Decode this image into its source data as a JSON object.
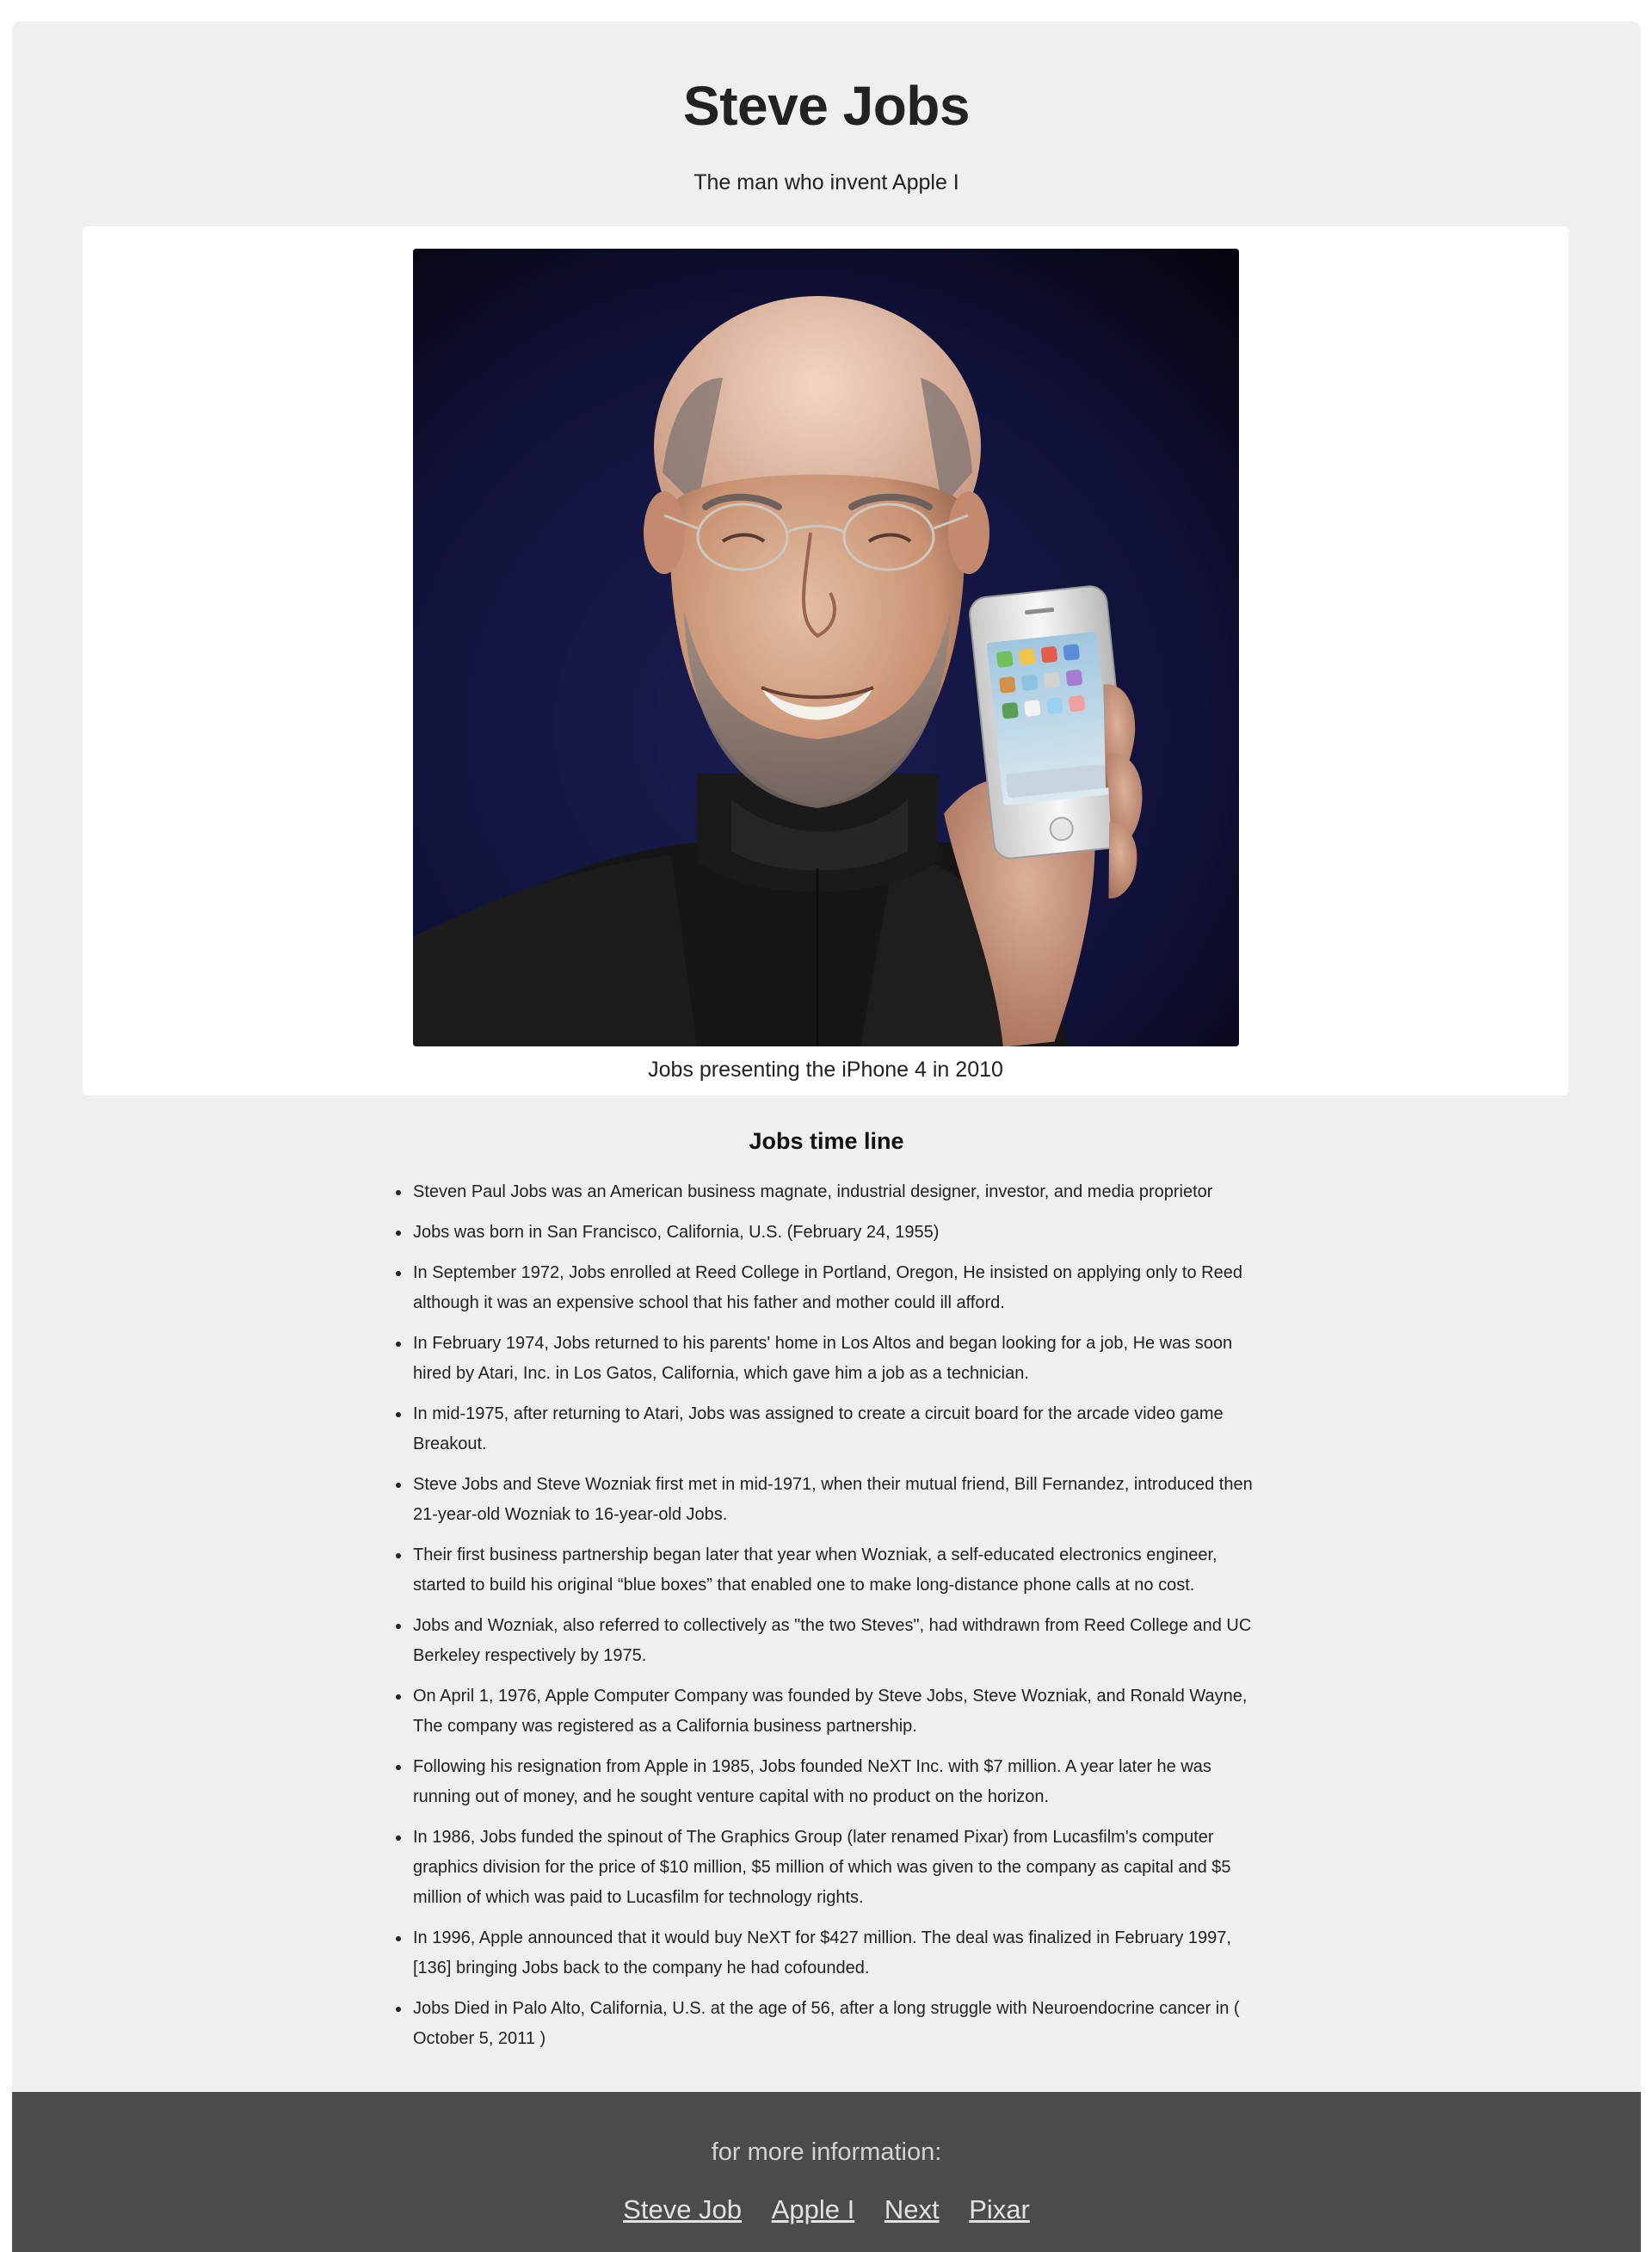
{
  "page": {
    "title": "Steve Jobs",
    "subtitle": "The man who invent Apple I"
  },
  "figure": {
    "image_alt": "Steve Jobs smiling and holding up an iPhone 4",
    "caption": "Jobs presenting the iPhone 4 in 2010"
  },
  "timeline": {
    "heading": "Jobs time line",
    "items": [
      "Steven Paul Jobs was an American business magnate, industrial designer, investor, and media proprietor",
      "Jobs was born in San Francisco, California, U.S. (February 24, 1955)",
      "In September 1972, Jobs enrolled at Reed College in Portland, Oregon, He insisted on applying only to Reed although it was an expensive school that his father and mother could ill afford.",
      "In February 1974, Jobs returned to his parents' home in Los Altos and began looking for a job, He was soon hired by Atari, Inc. in Los Gatos, California, which gave him a job as a technician.",
      "In mid-1975, after returning to Atari, Jobs was assigned to create a circuit board for the arcade video game Breakout.",
      "Steve Jobs and Steve Wozniak first met in mid-1971, when their mutual friend, Bill Fernandez, introduced then 21-year-old Wozniak to 16-year-old Jobs.",
      "Their first business partnership began later that year when Wozniak, a self-educated electronics engineer, started to build his original “blue boxes” that enabled one to make long-distance phone calls at no cost.",
      "Jobs and Wozniak, also referred to collectively as \"the two Steves\", had withdrawn from Reed College and UC Berkeley respectively by 1975.",
      "On April 1, 1976, Apple Computer Company was founded by Steve Jobs, Steve Wozniak, and Ronald Wayne, The company was registered as a California business partnership.",
      "Following his resignation from Apple in 1985, Jobs founded NeXT Inc. with $7 million. A year later he was running out of money, and he sought venture capital with no product on the horizon.",
      "In 1986, Jobs funded the spinout of The Graphics Group (later renamed Pixar) from Lucasfilm's computer graphics division for the price of $10 million, $5 million of which was given to the company as capital and $5 million of which was paid to Lucasfilm for technology rights.",
      "In 1996, Apple announced that it would buy NeXT for $427 million. The deal was finalized in February 1997, [136] bringing Jobs back to the company he had cofounded.",
      "Jobs Died in Palo Alto, California, U.S. at the age of 56, after a long struggle with Neuroendocrine cancer in ( October 5, 2011 )"
    ]
  },
  "footer": {
    "title": "for more information:",
    "links": [
      {
        "label": "Steve Job"
      },
      {
        "label": "Apple I"
      },
      {
        "label": "Next"
      },
      {
        "label": "Pixar"
      }
    ]
  },
  "colors": {
    "page_background": "#ffffff",
    "main_background": "#efefef",
    "card_background": "#ffffff",
    "footer_background": "#4b4b4b",
    "footer_text": "#d4d4d4",
    "text": "#222222"
  }
}
